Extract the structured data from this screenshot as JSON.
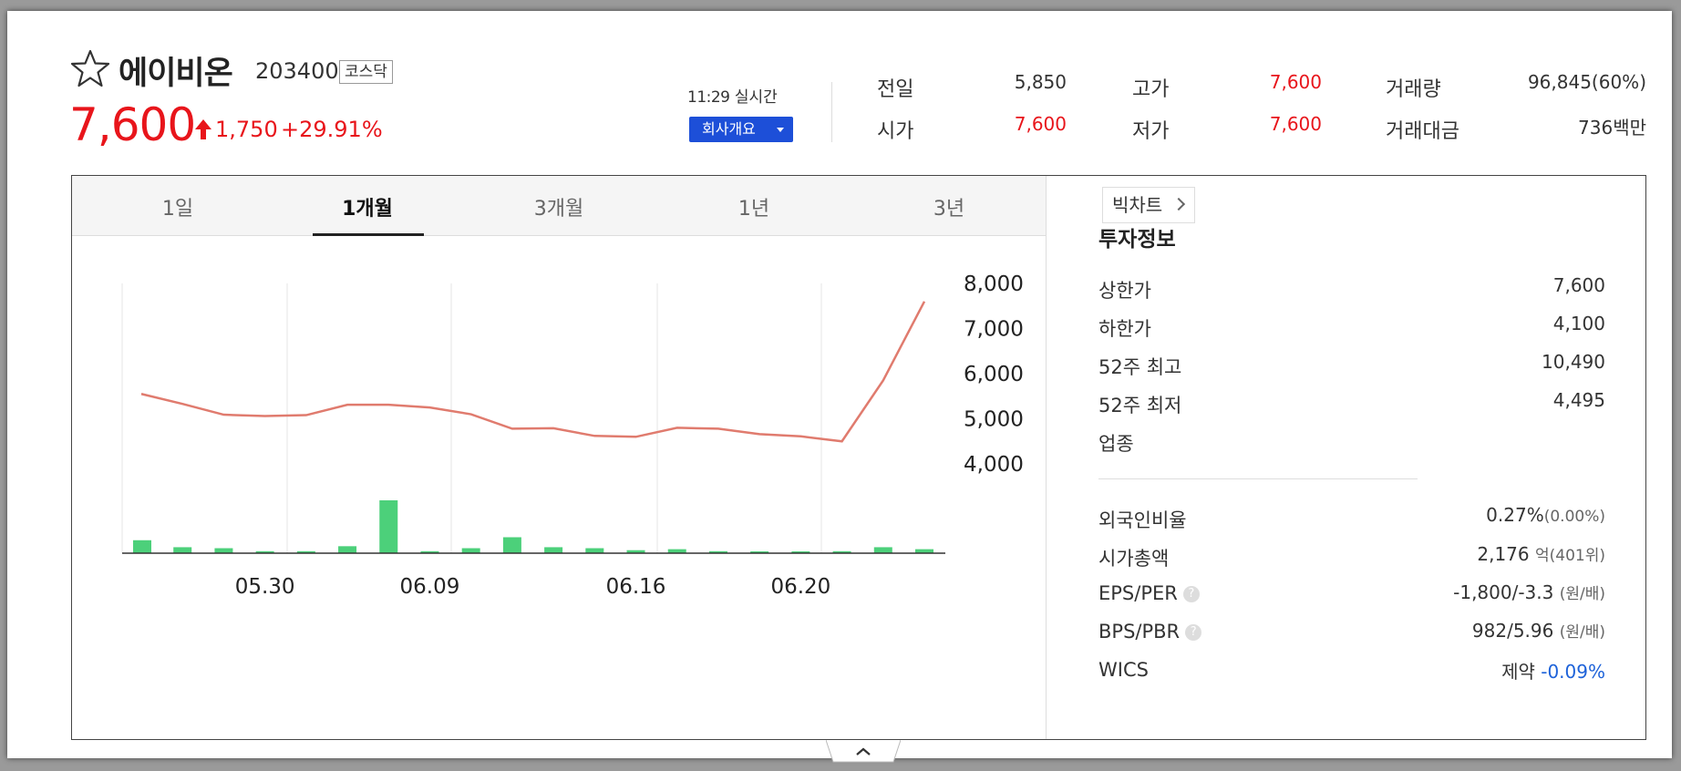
{
  "stock": {
    "name": "에이비온",
    "code": "203400",
    "market": "코스닥",
    "price": "7,600",
    "change": "1,750",
    "change_rate": "+29.91%",
    "realtime_time": "11:29",
    "realtime_label": "실시간",
    "company_info_button": "회사개요"
  },
  "summary": {
    "prev_close_label": "전일",
    "prev_close": "5,850",
    "open_label": "시가",
    "open": "7,600",
    "high_label": "고가",
    "high": "7,600",
    "low_label": "저가",
    "low": "7,600",
    "volume_label": "거래량",
    "volume": "96,845(60%)",
    "amount_label": "거래대금",
    "amount": "736백만"
  },
  "tabs": [
    {
      "label": "1일"
    },
    {
      "label": "1개월"
    },
    {
      "label": "3개월"
    },
    {
      "label": "1년"
    },
    {
      "label": "3년"
    }
  ],
  "big_chart_label": "빅차트",
  "invest": {
    "title": "투자정보",
    "upper_limit_label": "상한가",
    "upper_limit": "7,600",
    "lower_limit_label": "하한가",
    "lower_limit": "4,100",
    "high52_label": "52주 최고",
    "high52": "10,490",
    "low52_label": "52주 최저",
    "low52": "4,495",
    "industry_label": "업종",
    "foreign_label": "외국인비율",
    "foreign": "0.27%",
    "foreign_sub": "(0.00%)",
    "mcap_label": "시가총액",
    "mcap": "2,176",
    "mcap_unit": "억",
    "mcap_rank": "(401위)",
    "eps_label": "EPS/PER",
    "eps": "-1,800/-3.3",
    "eps_unit": "(원/배)",
    "bps_label": "BPS/PBR",
    "bps": "982/5.96",
    "bps_unit": "(원/배)",
    "wics_label": "WICS",
    "wics": "제약",
    "wics_change": "-0.09%",
    "help_glyph": "?"
  },
  "colors": {
    "up": "#e8151b",
    "down": "#1d62d9",
    "line": "#e07b6e",
    "volume_bar": "#4cd07a",
    "button": "#1d4fd8"
  },
  "chart_data": {
    "type": "line",
    "y_ticks": [
      "8,000",
      "7,000",
      "6,000",
      "5,000",
      "4,000"
    ],
    "ylim": [
      4000,
      8000
    ],
    "x_tick_labels": [
      "05.30",
      "06.09",
      "06.16",
      "06.20"
    ],
    "x_tick_indices": [
      3,
      7,
      12,
      16
    ],
    "price_series": [
      5550,
      5330,
      5090,
      5060,
      5080,
      5310,
      5310,
      5250,
      5100,
      4780,
      4790,
      4620,
      4600,
      4800,
      4780,
      4660,
      4610,
      4500,
      5850,
      7600
    ],
    "volume_series": [
      13,
      6,
      5,
      2,
      2,
      7,
      53,
      2,
      5,
      16,
      6,
      5,
      3,
      4,
      2,
      1,
      1,
      2,
      6,
      4
    ],
    "grid": true
  }
}
